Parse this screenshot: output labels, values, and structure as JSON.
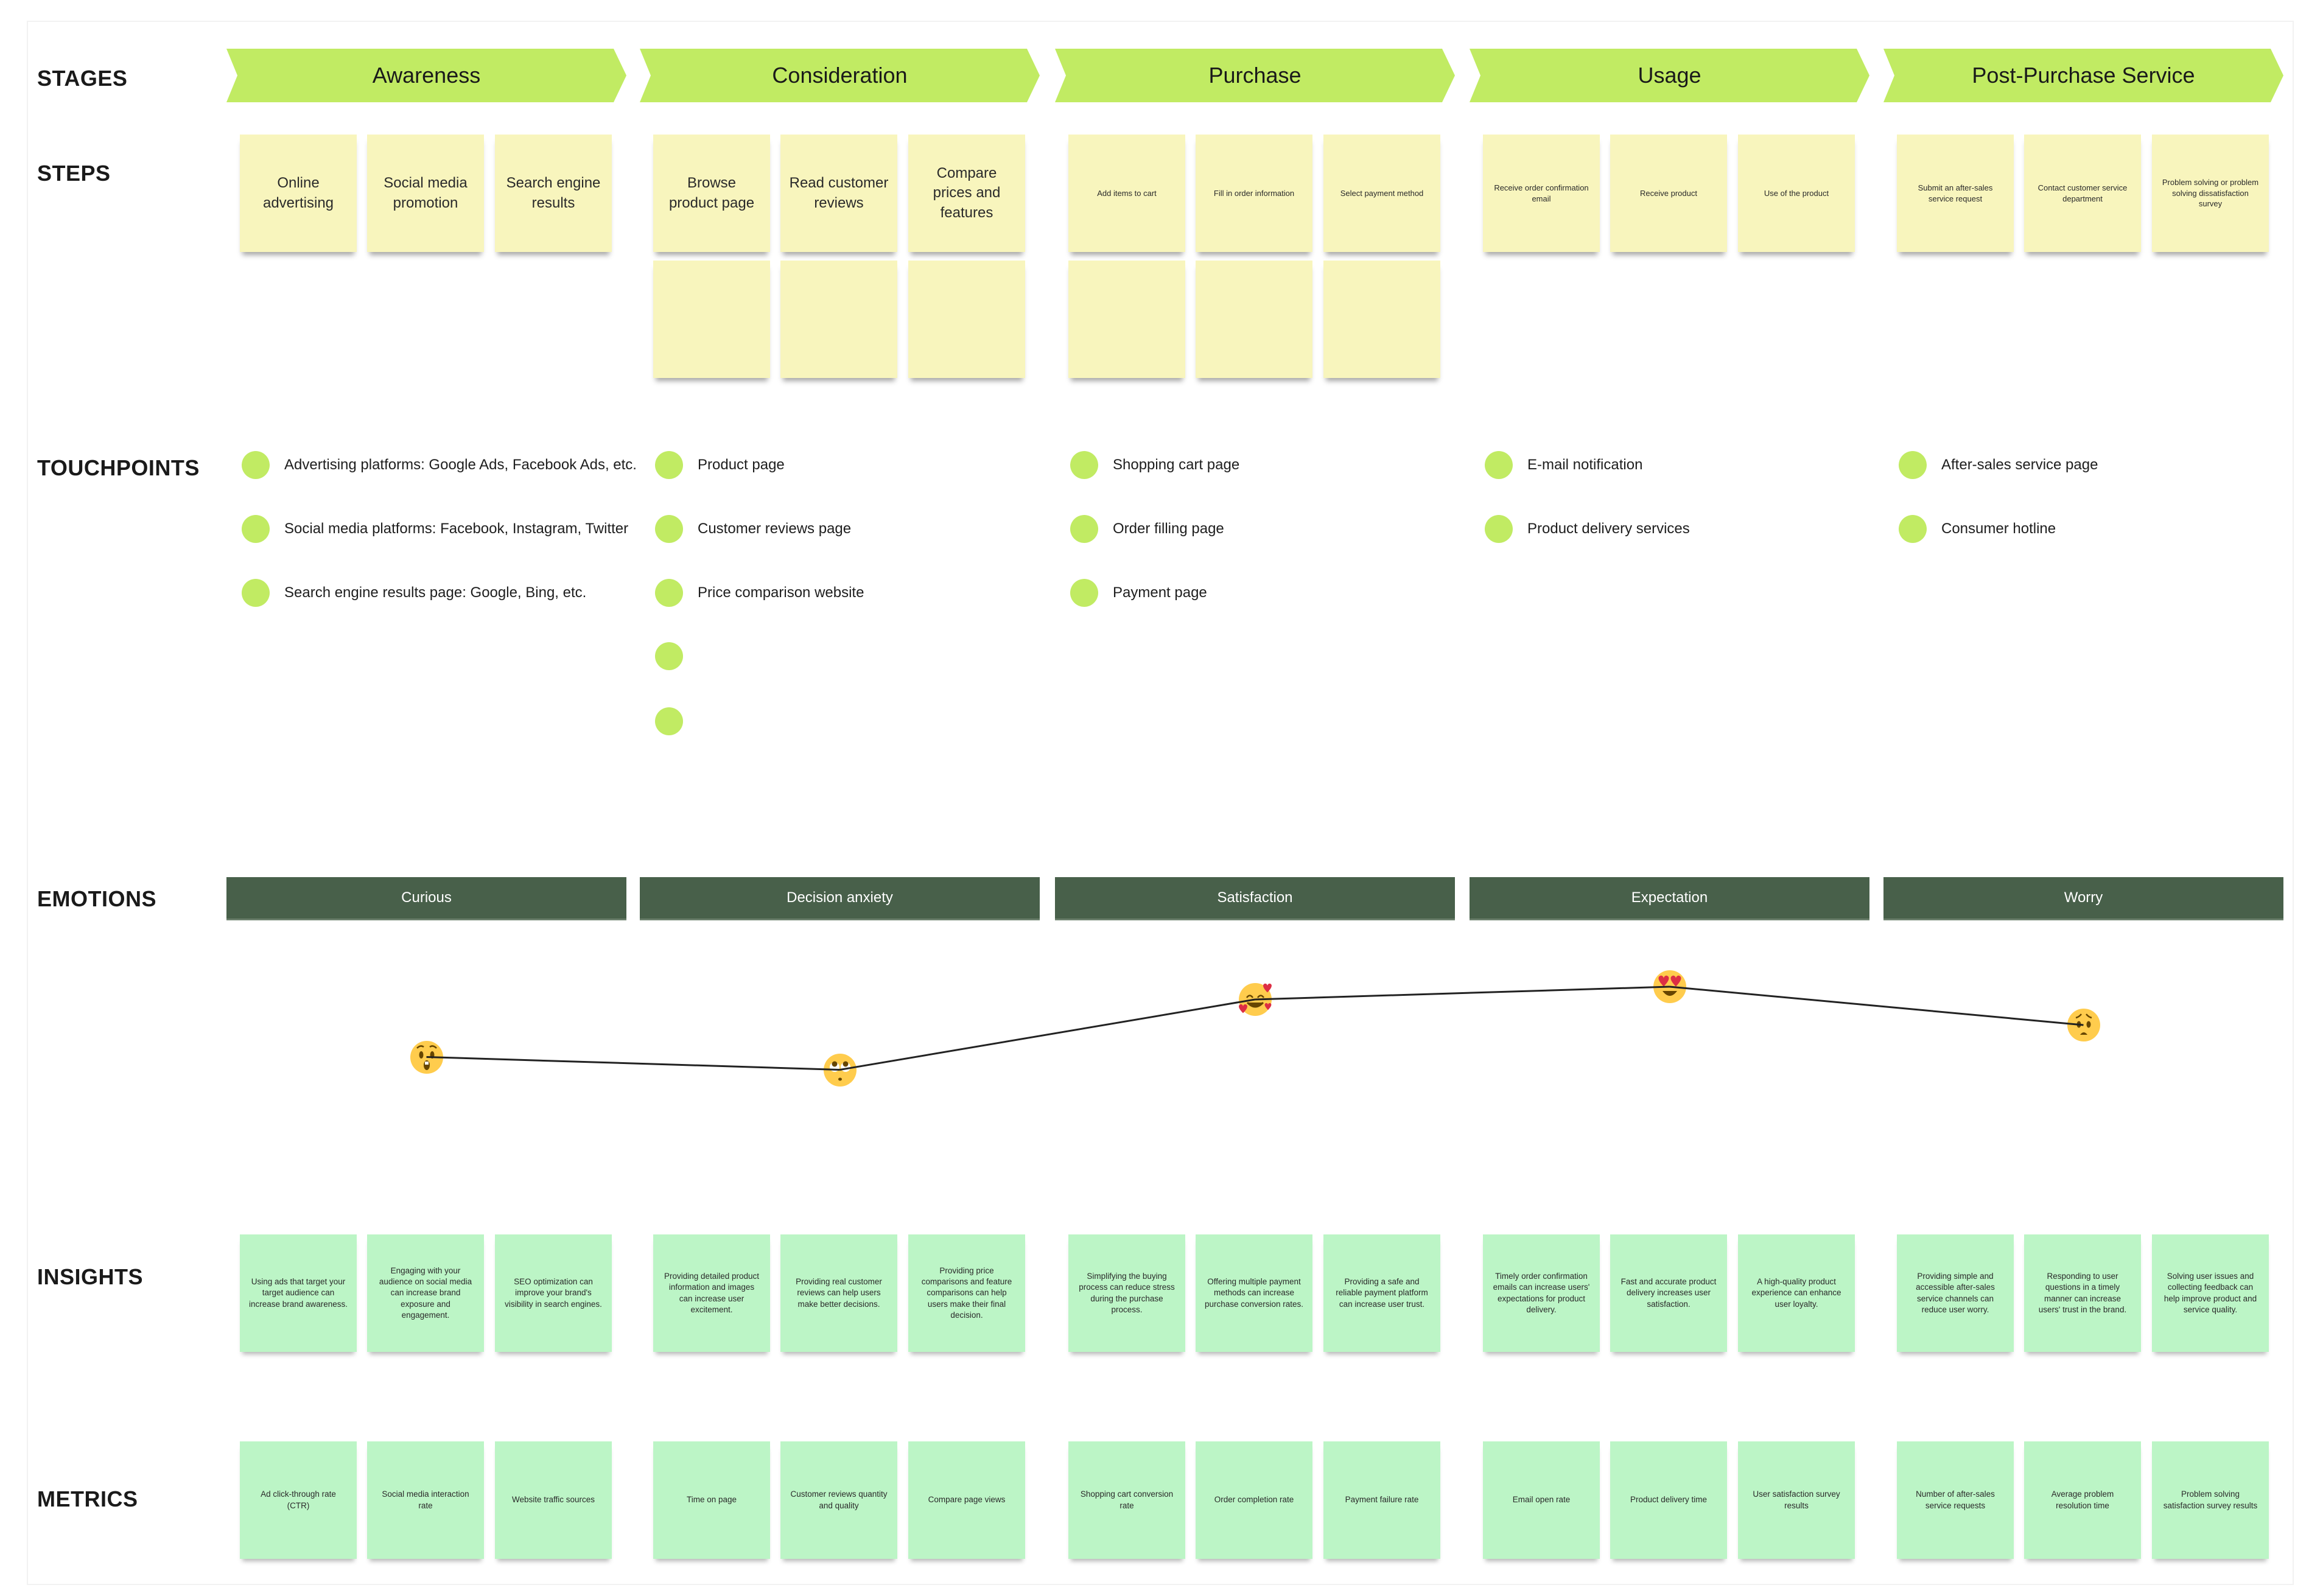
{
  "row_labels": {
    "stages": "STAGES",
    "steps": "STEPS",
    "touchpoints": "TOUCHPOINTS",
    "emotions": "EMOTIONS",
    "insights": "INSIGHTS",
    "metrics": "METRICS"
  },
  "colors": {
    "stage_fill": "#c1eb63",
    "step_sticky": "#f8f5bd",
    "green_sticky": "#bcf5c6",
    "emotion_bar": "#48604a",
    "touchpoint_dot": "#c1eb63"
  },
  "stages": [
    {
      "name": "Awareness",
      "steps": [
        "Online advertising",
        "Social media promotion",
        "Search engine results"
      ],
      "extra_empty_steps": 0,
      "touchpoints": [
        "Advertising platforms: Google Ads, Facebook Ads, etc.",
        "Social media platforms: Facebook, Instagram, Twitter",
        "Search engine results page: Google, Bing, etc."
      ],
      "emotion": "Curious",
      "emoji": "astonished-face",
      "insights": [
        "Using ads that target your target audience can increase brand awareness.",
        "Engaging with your audience on social media can increase brand exposure and engagement.",
        "SEO optimization can improve your brand's visibility in search engines."
      ],
      "metrics": [
        "Ad click-through rate (CTR)",
        "Social media interaction rate",
        "Website traffic sources"
      ]
    },
    {
      "name": "Consideration",
      "steps": [
        "Browse product page",
        "Read customer reviews",
        "Compare prices and features"
      ],
      "extra_empty_steps": 3,
      "touchpoints": [
        "Product page",
        "Customer reviews page",
        "Price comparison website",
        "",
        ""
      ],
      "emotion": "Decision anxiety",
      "emoji": "face-with-rolling-eyes",
      "insights": [
        "Providing detailed product information and images can increase user excitement.",
        "Providing real customer reviews can help users make better decisions.",
        "Providing price comparisons and feature comparisons can help users make their final decision."
      ],
      "metrics": [
        "Time on page",
        "Customer reviews quantity and quality",
        "Compare page views"
      ]
    },
    {
      "name": "Purchase",
      "steps": [
        "Add items to cart",
        "Fill in order information",
        "Select payment method"
      ],
      "extra_empty_steps": 3,
      "touchpoints": [
        "Shopping cart page",
        "Order filling page",
        "Payment page"
      ],
      "emotion": "Satisfaction",
      "emoji": "smiling-face-with-hearts",
      "insights": [
        "Simplifying the buying process can reduce stress during the purchase process.",
        "Offering multiple payment methods can increase purchase conversion rates.",
        "Providing a safe and reliable payment platform can increase user trust."
      ],
      "metrics": [
        "Shopping cart conversion rate",
        "Order completion rate",
        "Payment failure rate"
      ]
    },
    {
      "name": "Usage",
      "steps": [
        "Receive order confirmation email",
        "Receive product",
        "Use of the product"
      ],
      "extra_empty_steps": 0,
      "touchpoints": [
        "E-mail notification",
        "Product delivery services"
      ],
      "emotion": "Expectation",
      "emoji": "heart-eyes-face",
      "insights": [
        "Timely order confirmation emails can increase users' expectations for product delivery.",
        "Fast and accurate product delivery increases user satisfaction.",
        "A high-quality product experience can enhance user loyalty."
      ],
      "metrics": [
        "Email open rate",
        "Product delivery time",
        "User satisfaction survey results"
      ]
    },
    {
      "name": "Post-Purchase Service",
      "steps": [
        "Submit an after-sales service request",
        "Contact customer service department",
        "Problem solving or problem solving dissatisfaction survey"
      ],
      "extra_empty_steps": 0,
      "touchpoints": [
        "After-sales service page",
        "Consumer hotline"
      ],
      "emotion": "Worry",
      "emoji": "worried-face",
      "insights": [
        "Providing simple and accessible after-sales service channels can reduce user worry.",
        "Responding to user questions in a timely manner can increase users' trust in the brand.",
        "Solving user issues and collecting feedback can help improve product and service quality."
      ],
      "metrics": [
        "Number of after-sales service requests",
        "Average problem resolution time",
        "Problem solving satisfaction survey results"
      ]
    }
  ],
  "emotion_curve": {
    "scale_note": "relative sentiment level, higher is more positive",
    "levels": [
      0.35,
      0.25,
      0.8,
      0.9,
      0.6
    ]
  }
}
